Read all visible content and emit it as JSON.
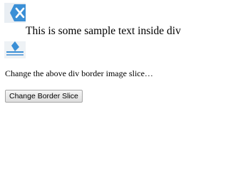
{
  "sample_box": {
    "text": "This is some sample text inside div"
  },
  "instruction": {
    "text": "Change the above div border image slice…"
  },
  "button": {
    "label": "Change Border Slice"
  },
  "colors": {
    "border_image_blue": "#3a8fd6",
    "border_image_light": "#e9eef3",
    "button_border": "#a6a6a6"
  },
  "icons": {
    "border_image": "x-logo-icon"
  }
}
